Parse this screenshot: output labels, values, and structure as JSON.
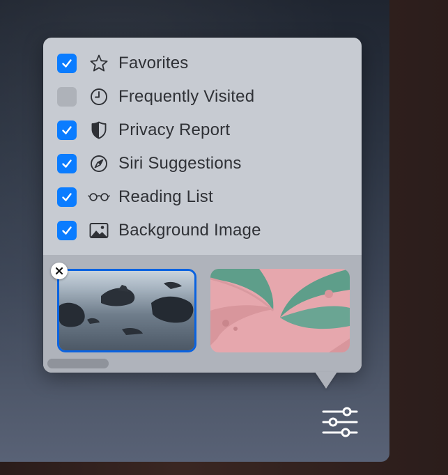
{
  "options": [
    {
      "label": "Favorites",
      "checked": true,
      "icon": "star-icon"
    },
    {
      "label": "Frequently Visited",
      "checked": false,
      "icon": "clock-icon"
    },
    {
      "label": "Privacy Report",
      "checked": true,
      "icon": "shield-icon"
    },
    {
      "label": "Siri Suggestions",
      "checked": true,
      "icon": "compass-icon"
    },
    {
      "label": "Reading List",
      "checked": true,
      "icon": "glasses-icon"
    },
    {
      "label": "Background Image",
      "checked": true,
      "icon": "photo-icon"
    }
  ],
  "background_images": {
    "items": [
      {
        "name": "rocky-sea",
        "selected": true
      },
      {
        "name": "butterfly",
        "selected": false
      }
    ],
    "remove_icon": "close-icon"
  },
  "customize_button": {
    "icon": "sliders-icon"
  },
  "colors": {
    "accent": "#0a7cff",
    "selection_border": "#0a62e0",
    "popover_bg": "#c7cbd2",
    "tray_bg": "#afb3bb",
    "text": "#2f3136"
  }
}
